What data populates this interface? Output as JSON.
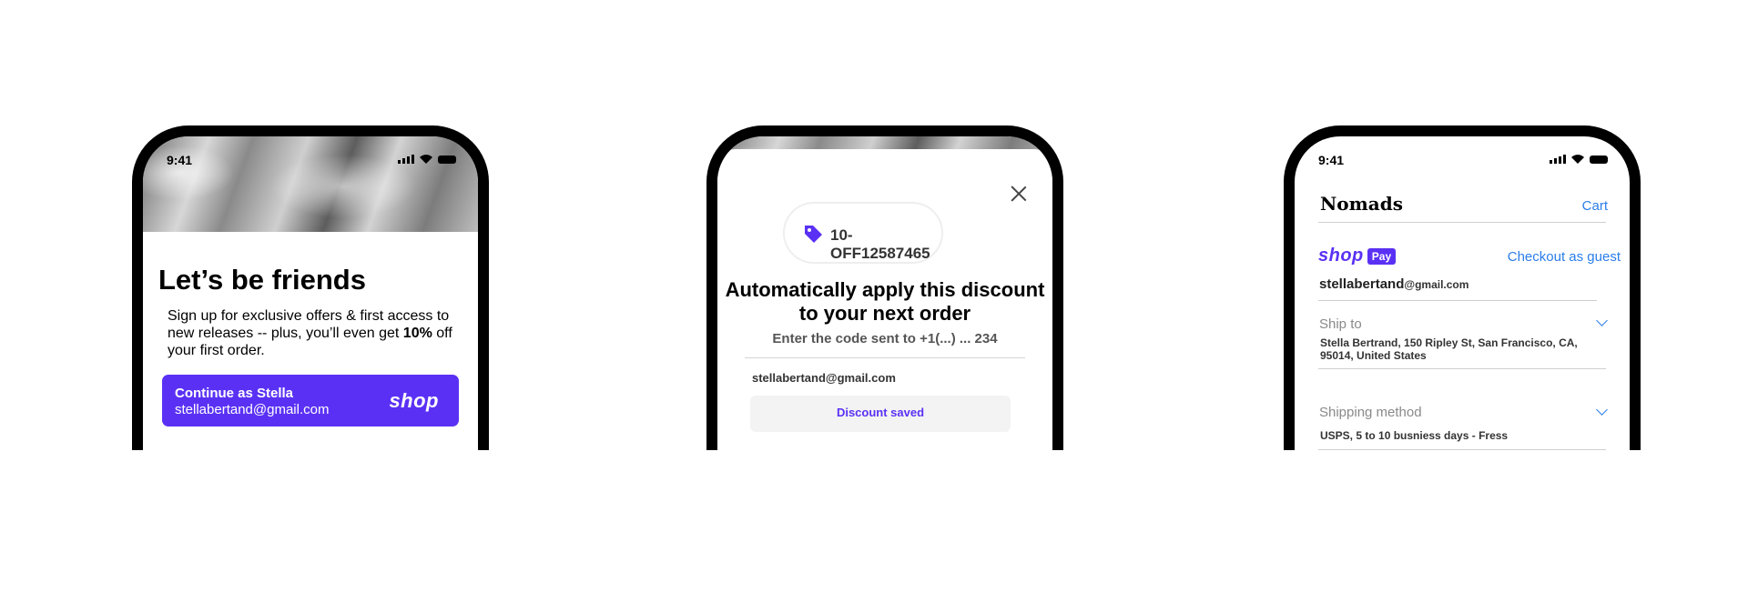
{
  "phone1": {
    "status_time": "9:41",
    "title": "Let’s be friends",
    "body_before": "Sign up for exclusive offers & first access to new releases -- plus, you’ll even get ",
    "body_bold": "10%",
    "body_after": " off your first order.",
    "cta_line1": "Continue as Stella",
    "cta_line2": "stellabertand@gmail.com",
    "cta_logo": "shop"
  },
  "phone2": {
    "discount_code": "10-OFF12587465",
    "heading": "Automatically apply this discount to your next order",
    "sub": "Enter the code sent to +1(...) ... 234",
    "email": "stellabertand@gmail.com",
    "saved_label": "Discount saved"
  },
  "phone3": {
    "status_time": "9:41",
    "brand": "Nomads",
    "cart_label": "Cart",
    "shop_logo": "shop",
    "pay_badge": "Pay",
    "guest_label": "Checkout as guest",
    "email_user": "stellabertand",
    "email_domain": "@gmail.com",
    "ship_label": "Ship to",
    "ship_value": "Stella Bertrand, 150 Ripley St, San Francisco, CA, 95014, United States",
    "shipping_method_label": "Shipping method",
    "shipping_method_value": "USPS, 5 to 10 busniess days - Fress"
  },
  "colors": {
    "shop_purple": "#5a31f4",
    "link_blue": "#2b7de9"
  }
}
